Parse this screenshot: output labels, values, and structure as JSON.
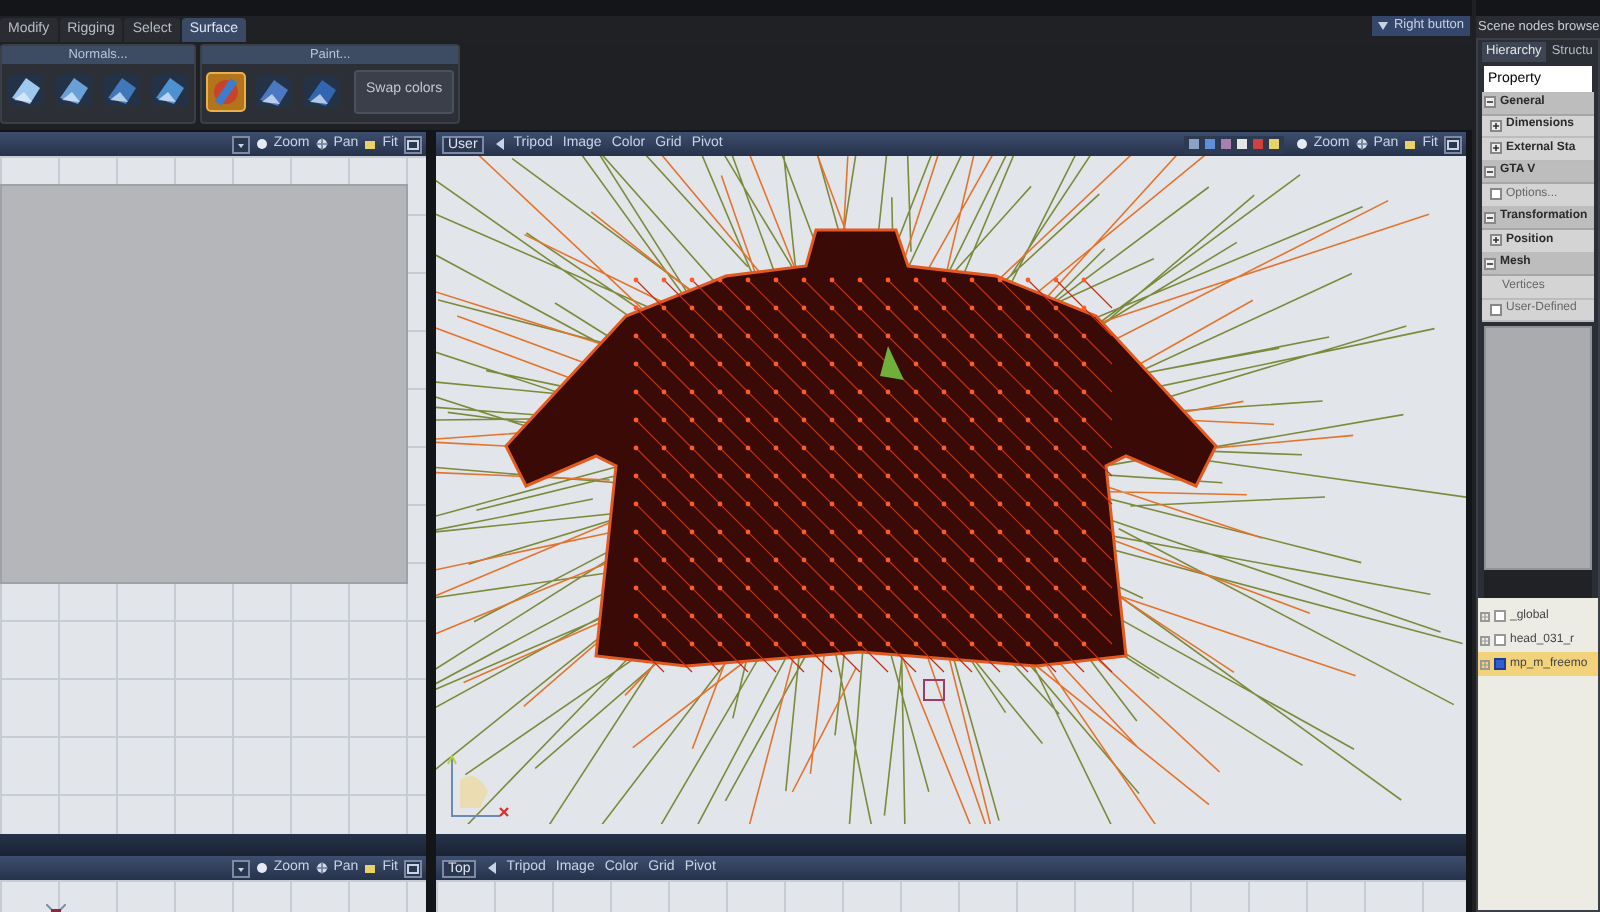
{
  "tabs": [
    {
      "label": "Modify",
      "selected": false
    },
    {
      "label": "Rigging",
      "selected": false
    },
    {
      "label": "Select",
      "selected": false
    },
    {
      "label": "Surface",
      "selected": true
    }
  ],
  "ribbon": {
    "groups": [
      {
        "title": "Normals..."
      },
      {
        "title": "Paint...",
        "buttons": [
          "Swap colors"
        ]
      }
    ]
  },
  "right_button": "Right button",
  "viewports": [
    {
      "nav": [
        "Zoom",
        "Pan",
        "Fit"
      ]
    },
    {
      "view": "User",
      "menu": [
        "Tripod",
        "Image",
        "Color",
        "Grid",
        "Pivot"
      ],
      "nav": [
        "Zoom",
        "Pan",
        "Fit"
      ]
    },
    {
      "nav": [
        "Zoom",
        "Pan",
        "Fit"
      ]
    },
    {
      "view": "Top",
      "menu": [
        "Tripod",
        "Image",
        "Color",
        "Grid",
        "Pivot"
      ]
    }
  ],
  "scene_browser": {
    "title": "Scene nodes browse",
    "tabs": [
      {
        "label": "Hierarchy",
        "selected": true
      },
      {
        "label": "Structu",
        "selected": false
      }
    ],
    "property_header": "Property",
    "tree": [
      {
        "label": "General",
        "expanded": true,
        "children": [
          {
            "label": "Dimensions",
            "expanded": false
          },
          {
            "label": "External Sta",
            "expanded": false
          }
        ]
      },
      {
        "label": "GTA V",
        "expanded": true,
        "children": [
          {
            "label": "Options...",
            "kind": "checkbox",
            "checked": false
          }
        ]
      },
      {
        "label": "Transformation",
        "expanded": true,
        "children": [
          {
            "label": "Position",
            "expanded": false
          }
        ]
      },
      {
        "label": "Mesh",
        "expanded": true,
        "children": [
          {
            "label": "Vertices",
            "kind": "leaf"
          },
          {
            "label": "User-Defined",
            "kind": "checkbox",
            "checked": false
          }
        ]
      }
    ],
    "nodes": [
      {
        "label": "_global",
        "checked": false,
        "selected": false
      },
      {
        "label": "head_031_r",
        "checked": false,
        "selected": false
      },
      {
        "label": "mp_m_freemo",
        "checked": true,
        "selected": true
      }
    ]
  }
}
